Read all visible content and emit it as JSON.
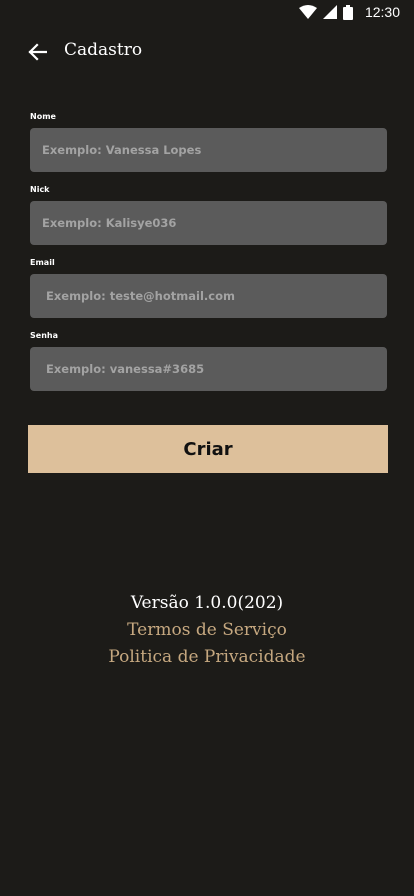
{
  "status_bar": {
    "time": "12:30",
    "icons": [
      "wifi-icon",
      "signal-icon",
      "battery-icon"
    ]
  },
  "app_bar": {
    "back_icon": "arrow-back-icon",
    "title": "Cadastro"
  },
  "form": {
    "fields": [
      {
        "label": "Nome",
        "placeholder": "Exemplo: Vanessa Lopes",
        "value": ""
      },
      {
        "label": "Nick",
        "placeholder": "Exemplo: Kalisye036",
        "value": ""
      },
      {
        "label": "Email",
        "placeholder": "Exemplo: teste@hotmail.com",
        "value": ""
      },
      {
        "label": "Senha",
        "placeholder": "Exemplo: vanessa#3685",
        "value": ""
      }
    ],
    "submit_label": "Criar"
  },
  "footer": {
    "version": "Versão 1.0.0(202)",
    "terms_link": "Termos de Serviço",
    "privacy_link": "Politica de Privacidade"
  },
  "colors": {
    "background": "#1c1b18",
    "input_background": "#5b5b5b",
    "placeholder": "#a3a3a3",
    "button": "#ddc09b",
    "link": "#c6a880"
  }
}
